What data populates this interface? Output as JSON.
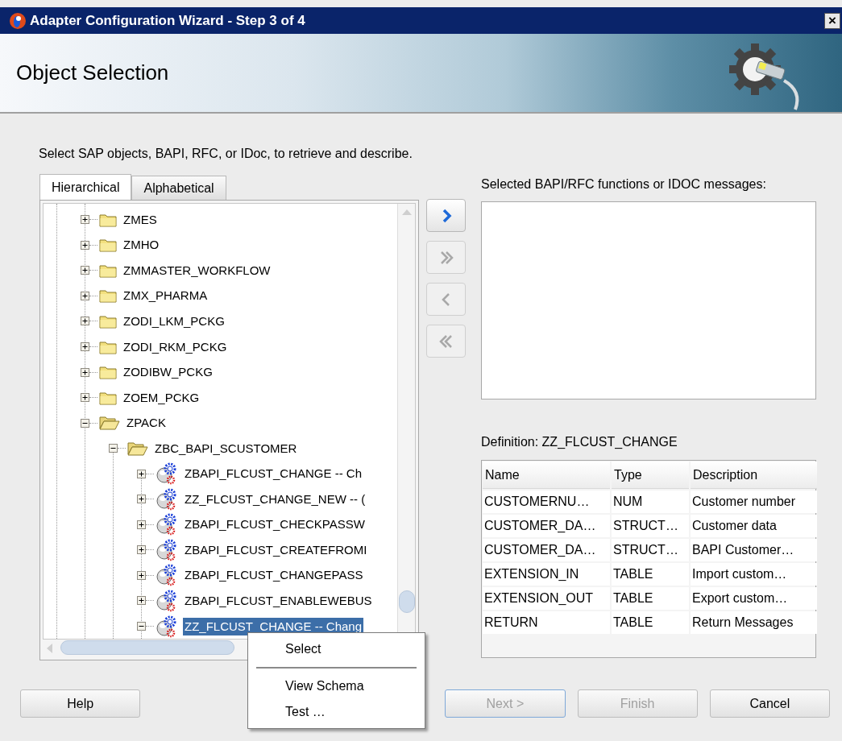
{
  "window": {
    "title": "Adapter Configuration Wizard - Step 3 of 4",
    "close": "×"
  },
  "header": {
    "title": "Object Selection"
  },
  "instruction": "Select SAP objects, BAPI, RFC, or IDoc, to retrieve and describe.",
  "tabs": [
    {
      "label": "Hierarchical",
      "selected": true
    },
    {
      "label": "Alphabetical",
      "selected": false
    }
  ],
  "tree": {
    "items": [
      {
        "label": "ZMES",
        "kind": "folder",
        "expanded": false,
        "selected": false
      },
      {
        "label": "ZMHO",
        "kind": "folder",
        "expanded": false,
        "selected": false
      },
      {
        "label": "ZMMASTER_WORKFLOW",
        "kind": "folder",
        "expanded": false,
        "selected": false
      },
      {
        "label": "ZMX_PHARMA",
        "kind": "folder",
        "expanded": false,
        "selected": false
      },
      {
        "label": "ZODI_LKM_PCKG",
        "kind": "folder",
        "expanded": false,
        "selected": false
      },
      {
        "label": "ZODI_RKM_PCKG",
        "kind": "folder",
        "expanded": false,
        "selected": false
      },
      {
        "label": "ZODIBW_PCKG",
        "kind": "folder",
        "expanded": false,
        "selected": false
      },
      {
        "label": "ZOEM_PCKG",
        "kind": "folder",
        "expanded": false,
        "selected": false
      },
      {
        "label": "ZPACK",
        "kind": "folder",
        "expanded": true,
        "selected": false,
        "children": [
          {
            "label": "ZBC_BAPI_SCUSTOMER",
            "kind": "folder",
            "expanded": true,
            "selected": false,
            "children": [
              {
                "label": "ZBAPI_FLCUST_CHANGE -- Ch",
                "kind": "function",
                "expanded": false,
                "selected": false
              },
              {
                "label": "ZZ_FLCUST_CHANGE_NEW -- (",
                "kind": "function",
                "expanded": false,
                "selected": false
              },
              {
                "label": "ZBAPI_FLCUST_CHECKPASSW",
                "kind": "function",
                "expanded": false,
                "selected": false
              },
              {
                "label": "ZBAPI_FLCUST_CREATEFROMI",
                "kind": "function",
                "expanded": false,
                "selected": false
              },
              {
                "label": "ZBAPI_FLCUST_CHANGEPASS",
                "kind": "function",
                "expanded": false,
                "selected": false
              },
              {
                "label": "ZBAPI_FLCUST_ENABLEWEBUS",
                "kind": "function",
                "expanded": false,
                "selected": false
              },
              {
                "label": "ZZ_FLCUST_CHANGE -- Chang",
                "kind": "function",
                "expanded": true,
                "selected": true
              }
            ]
          }
        ]
      }
    ]
  },
  "move_buttons": [
    {
      "kind": "add",
      "disabled": false
    },
    {
      "kind": "add_all",
      "disabled": true
    },
    {
      "kind": "remove",
      "disabled": true
    },
    {
      "kind": "remove_all",
      "disabled": true
    }
  ],
  "selected_list": {
    "label": "Selected BAPI/RFC functions or IDOC messages:"
  },
  "definition": {
    "label": "Definition: ZZ_FLCUST_CHANGE",
    "columns": [
      "Name",
      "Type",
      "Description"
    ],
    "rows": [
      [
        "CUSTOMERNU…",
        "NUM",
        "Customer number"
      ],
      [
        "CUSTOMER_DA…",
        "STRUCT…",
        "Customer data"
      ],
      [
        "CUSTOMER_DA…",
        "STRUCT…",
        "BAPI Customer…"
      ],
      [
        "EXTENSION_IN",
        "TABLE",
        "Import custom…"
      ],
      [
        "EXTENSION_OUT",
        "TABLE",
        "Export custom…"
      ],
      [
        "RETURN",
        "TABLE",
        "Return Messages"
      ]
    ]
  },
  "buttons": [
    {
      "label": "Help",
      "disabled": false,
      "focused": false
    },
    {
      "label": "Next >",
      "disabled": true,
      "focused": true
    },
    {
      "label": "Finish",
      "disabled": true,
      "focused": false
    },
    {
      "label": "Cancel",
      "disabled": false,
      "focused": false
    }
  ],
  "context_menu": [
    {
      "kind": "item",
      "label": "Select"
    },
    {
      "kind": "separator"
    },
    {
      "kind": "item",
      "label": "View Schema"
    },
    {
      "kind": "item",
      "label": "Test …"
    }
  ]
}
